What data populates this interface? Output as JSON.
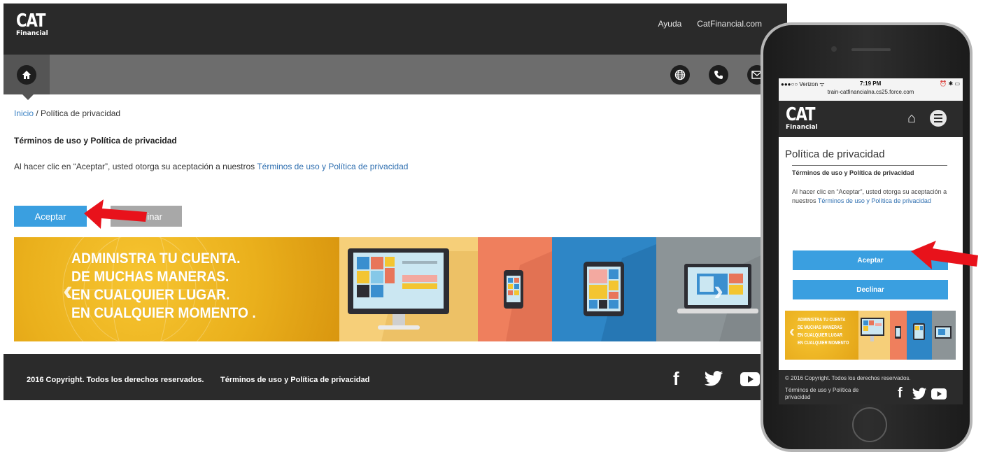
{
  "brand": {
    "logo_big": "CAT",
    "logo_small": "Financial"
  },
  "desktop": {
    "top_links": [
      "Ayuda",
      "CatFinancial.com"
    ],
    "nav_icons": [
      "home-icon",
      "globe-icon",
      "phone-icon",
      "mail-icon"
    ],
    "breadcrumb": {
      "home": "Inicio",
      "separator": " / ",
      "current": "Política de privacidad"
    },
    "title": "Términos de uso y Política de privacidad",
    "lead_text": "Al hacer clic en “Aceptar”, usted otorga su aceptación a nuestros ",
    "lead_link": "Términos de uso y Política de privacidad",
    "accept_label": "Aceptar",
    "decline_label_visible": "inar",
    "banner_lines": [
      "ADMINISTRA TU CUENTA.",
      "DE MUCHAS MANERAS.",
      "EN CUALQUIER LUGAR.",
      "EN CUALQUIER MOMENTO ."
    ],
    "footer_copy": "2016 Copyright. Todos los derechos reservados.",
    "footer_terms": "Términos de uso y Política de privacidad",
    "social": [
      "f",
      "facebook-icon",
      "twitter-icon",
      "youtube-icon"
    ]
  },
  "mobile": {
    "status": {
      "carrier": "●●●○○ Verizon ᯤ",
      "time": "7:19 PM",
      "indicators": "⏰ ✱ ▭",
      "url": "train-catfinancialna.cs25.force.com"
    },
    "page_title": "Política de privacidad",
    "section_title": "Términos de uso y Política de privacidad",
    "body_text": "Al hacer clic en “Aceptar”, usted otorga su aceptación a nuestros ",
    "body_link": "Términos de uso y Política de privacidad",
    "accept_label": "Aceptar",
    "decline_label": "Declinar",
    "banner_lines": [
      "ADMINISTRA TU CUENTA",
      "DE MUCHAS MANERAS",
      "EN CUALQUIER LUGAR",
      "EN CUALQUIER MOMENTO"
    ],
    "footer_copy": "© 2016 Copyright. Todos los derechos reservados.",
    "footer_terms": "Términos de uso y Política de privacidad"
  },
  "colors": {
    "accent": "#3a9fe0",
    "dark": "#2a2a2a",
    "arrow": "#e8121b",
    "banner_yellow": "#f2b21a"
  }
}
